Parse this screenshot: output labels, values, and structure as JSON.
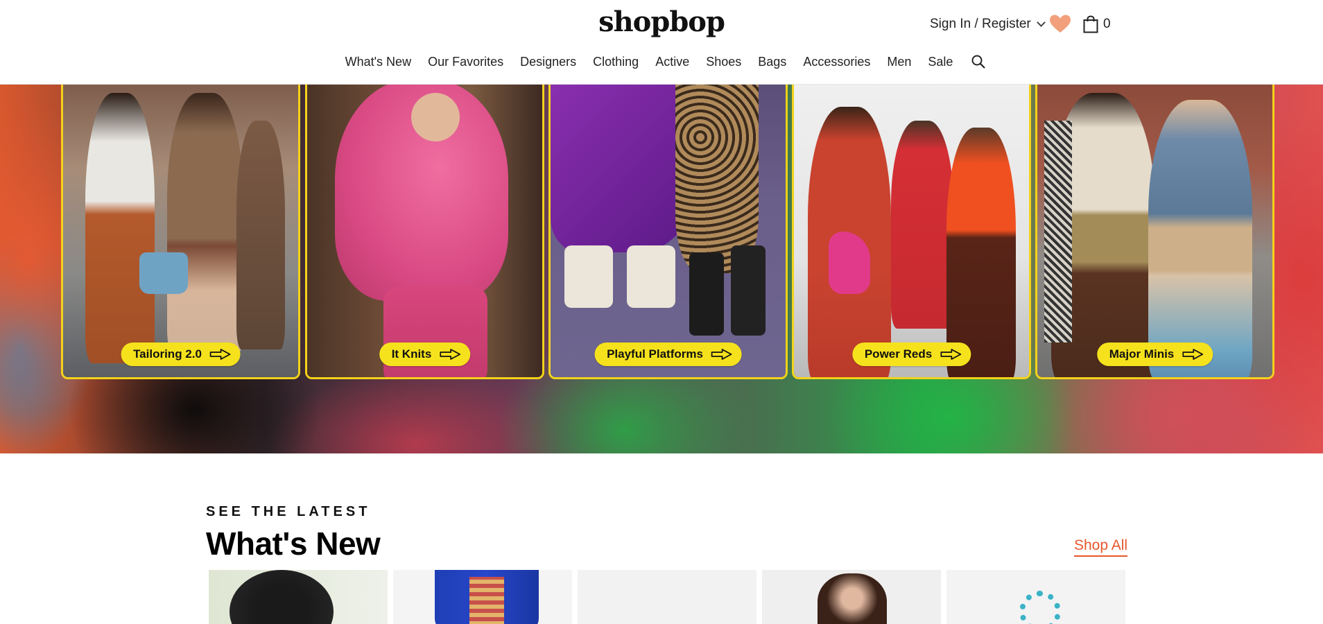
{
  "header": {
    "logo": "shopbop",
    "account_label": "Sign In / Register",
    "bag_count": "0",
    "nav": [
      "What's New",
      "Our Favorites",
      "Designers",
      "Clothing",
      "Active",
      "Shoes",
      "Bags",
      "Accessories",
      "Men",
      "Sale"
    ]
  },
  "hero": {
    "tiles": [
      {
        "label": "Tailoring 2.0"
      },
      {
        "label": "It Knits"
      },
      {
        "label": "Playful Platforms"
      },
      {
        "label": "Power Reds"
      },
      {
        "label": "Major Minis"
      }
    ]
  },
  "whats_new": {
    "eyebrow": "SEE THE LATEST",
    "title": "What's New",
    "shop_all": "Shop All"
  },
  "colors": {
    "accent": "#e6562b",
    "pill": "#f6e21c",
    "tile_border": "#f4d21a",
    "heart": "#f2a07b"
  }
}
